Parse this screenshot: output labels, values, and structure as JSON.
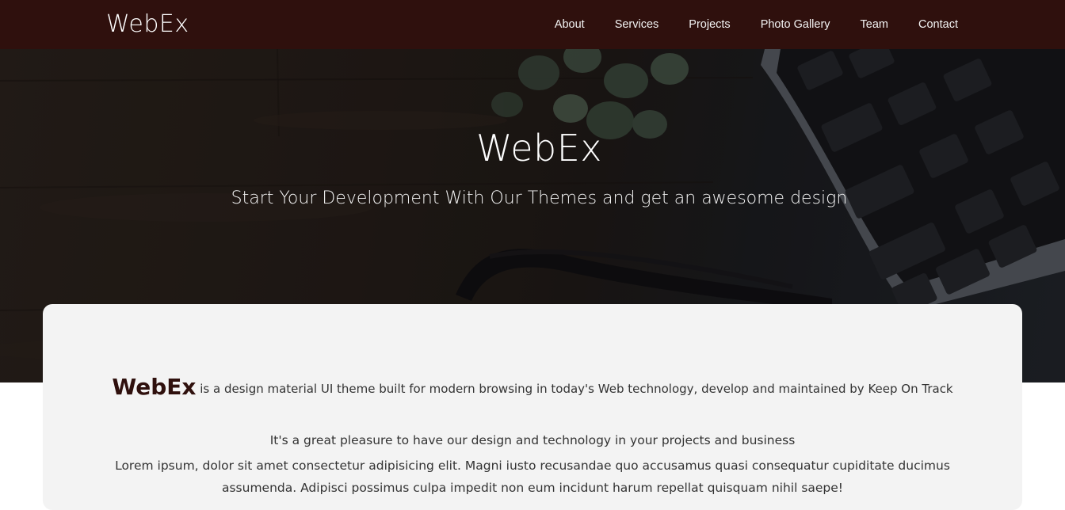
{
  "navbar": {
    "brand": "WebEx",
    "links": [
      "About",
      "Services",
      "Projects",
      "Photo Gallery",
      "Team",
      "Contact"
    ]
  },
  "hero": {
    "title": "WebEx",
    "subtitle": "Start Your Development With Our Themes and get an awesome design",
    "background_icon": "desk-photo-laptop-plant"
  },
  "about": {
    "brand": "WebEx",
    "intro": " is a design material UI theme built for modern browsing in today's Web technology, develop and maintained by Keep On Track",
    "pleasure": "It's a great pleasure to have our design and technology in your projects and business",
    "lorem": "Lorem ipsum, dolor sit amet consectetur adipisicing elit. Magni iusto recusandae quo accusamus quasi consequatur cupiditate ducimus assumenda. Adipisci possimus culpa impedit non eum incidunt harum repellat quisquam nihil saepe!"
  },
  "colors": {
    "navbar": "#2f100d",
    "card": "#f3f3f3",
    "brand_accent": "#2f100d"
  }
}
